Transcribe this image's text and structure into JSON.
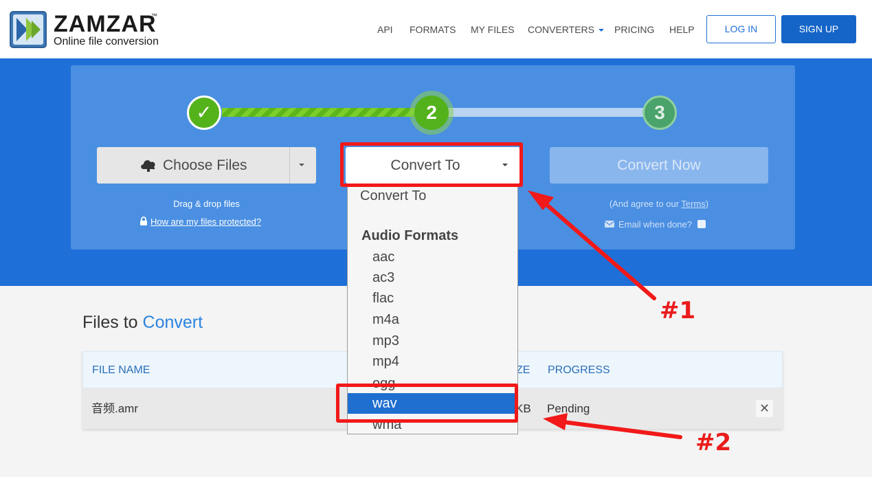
{
  "header": {
    "logo_title": "ZAMZAR",
    "logo_tm": "™",
    "logo_subtitle": "Online file conversion",
    "nav": {
      "api": "API",
      "formats": "FORMATS",
      "my_files": "MY FILES",
      "converters": "CONVERTERS",
      "pricing": "PRICING",
      "help": "HELP"
    },
    "login": "LOG IN",
    "signup": "SIGN UP"
  },
  "steps": {
    "step1": "✓",
    "step2": "2",
    "step3": "3"
  },
  "choose_files": {
    "label": "Choose Files",
    "drag_text": "Drag & drop files",
    "protect_link": "How are my files protected?"
  },
  "convert_to": {
    "label": "Convert To"
  },
  "convert_now": {
    "label": "Convert Now",
    "agree_prefix": "(And agree to our ",
    "agree_link": "Terms",
    "agree_suffix": ")",
    "email_label": "Email when done?"
  },
  "files_section": {
    "title_part1": "Files to ",
    "title_part2": "Convert",
    "columns": {
      "file_name": "FILE NAME",
      "size_fragment": "ZE",
      "progress": "PROGRESS"
    },
    "row": {
      "file_name": "音频.amr",
      "size_fragment": "KB",
      "progress": "Pending",
      "remove": "✕"
    }
  },
  "dropdown": {
    "first_option": "Convert To",
    "group_label": "Audio Formats",
    "options": [
      "aac",
      "ac3",
      "flac",
      "m4a",
      "mp3",
      "mp4",
      "ogg",
      "wav",
      "wma"
    ],
    "selected": "wav"
  },
  "annotations": {
    "label1": "#1",
    "label2": "#2",
    "color": "#f21919"
  },
  "colors": {
    "brand_blue": "#1f6fd8",
    "success_green": "#54b21b",
    "selected_blue": "#1e6fd0"
  }
}
